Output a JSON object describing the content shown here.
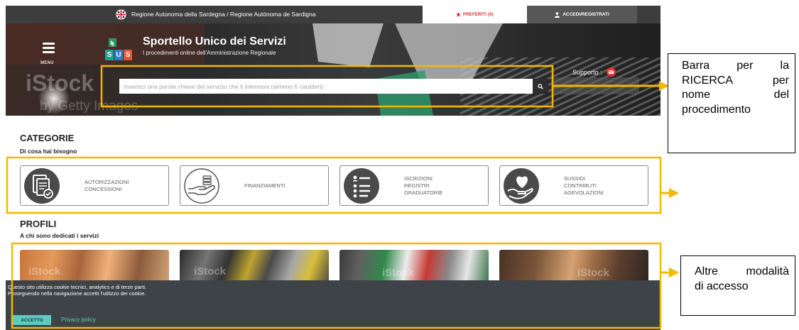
{
  "top_bar": {
    "region_logo_icon": "sardinia-flag-icon",
    "region_text": "Regione Autonoma della Sardegna / Regione Autònoma de Sardigna",
    "favorites_icon": "star-icon",
    "favorites_label": "PREFERITI (0)",
    "login_icon": "user-icon",
    "login_label": "ACCEDI/REGISTRATI"
  },
  "header": {
    "menu_icon": "hamburger-icon",
    "menu_label": "MENU",
    "logo_letters": [
      "S",
      "U",
      "S"
    ],
    "title": "Sportello Unico dei Servizi",
    "subtitle": "I procedimenti online dell'Amministrazione Regionale",
    "support_label": "Supporto :",
    "support_icon": "email-icon"
  },
  "search": {
    "value": "",
    "placeholder": "Inserisci una parola chiave del servizio che ti interessa (almeno 5 caratteri)",
    "button_icon": "search-icon"
  },
  "watermark": {
    "brand": "iStock",
    "credit": "by Getty Images"
  },
  "categories": {
    "heading": "CATEGORIE",
    "subheading": "Di cosa hai bisogno",
    "items": [
      {
        "icon": "documents-check-icon",
        "lines": [
          "AUTORIZZAZIONI",
          "CONCESSIONI"
        ]
      },
      {
        "icon": "hand-coins-icon",
        "lines": [
          "FINANZIAMENTI"
        ]
      },
      {
        "icon": "list-icon",
        "lines": [
          "ISCRIZIONI",
          "REGISTRI",
          "GRADUATORIE"
        ]
      },
      {
        "icon": "hand-heart-icon",
        "lines": [
          "SUSSIDI",
          "CONTRIBUTI",
          "AGEVOLAZIONI"
        ]
      }
    ]
  },
  "profiles": {
    "heading": "PROFILI",
    "subheading": "A chi sono dedicati i servizi"
  },
  "cookie": {
    "line1": "Questo sito utilizza cookie tecnici, analytics e di terze parti.",
    "line2": "Proseguendo nella navigazione accetti l'utilizzo dei cookie.",
    "accept_label": "ACCETTO",
    "privacy_label": "Privacy policy"
  },
  "annotations": {
    "search_note": {
      "lines": [
        "Barra per la",
        "RICERCA per",
        "nome del",
        "procedimento"
      ]
    },
    "access_note": {
      "lines": [
        "Altre modalità",
        "di accesso"
      ]
    }
  },
  "colors": {
    "annotation_yellow": "#f5b800",
    "cookie_accent": "#5ccbc3",
    "favorites_red": "#d7282f",
    "top_bar": "#3d3d3d",
    "cookie_banner": "#3e4347",
    "logo_s1": "#23a08e",
    "logo_u": "#2b7fc9",
    "logo_s2": "#e4552f"
  }
}
